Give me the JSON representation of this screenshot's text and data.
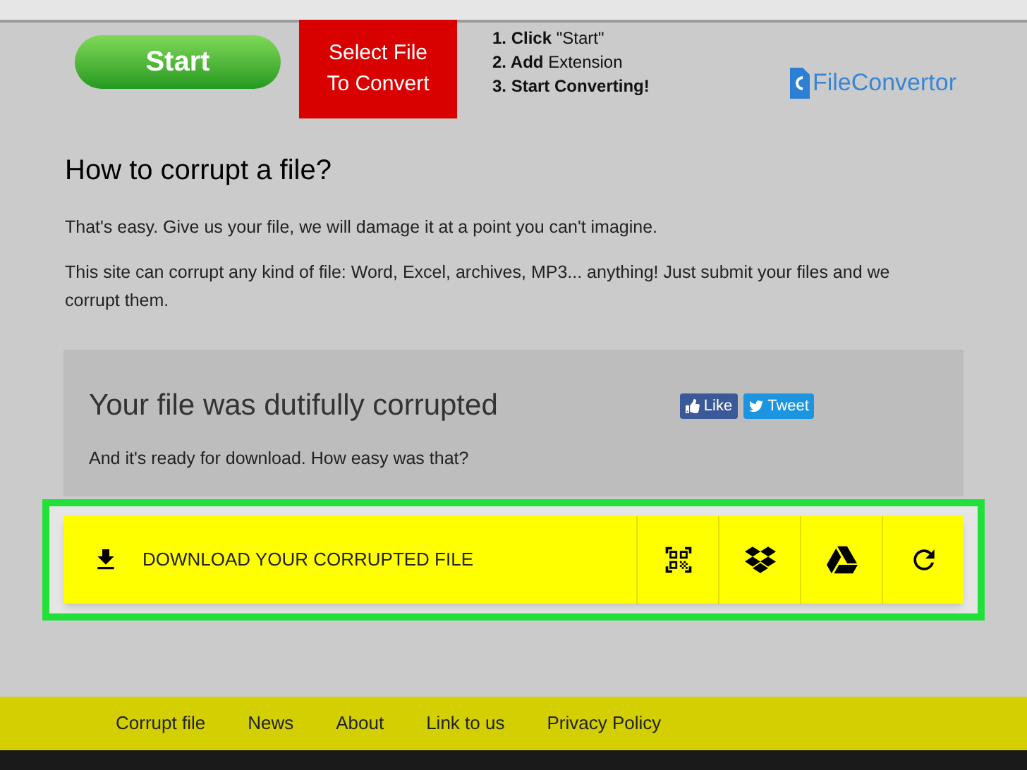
{
  "header": {
    "start_button": "Start",
    "select_button": "Select File To Convert",
    "steps": [
      {
        "text": "**1. Click** \"Start\"",
        "bold": false
      },
      {
        "text": "**2. Add** Extension",
        "bold": false
      },
      {
        "text": "3. Start Converting!",
        "bold": true
      }
    ],
    "logo": "FileConvertor"
  },
  "article": {
    "heading": "How to corrupt a file?",
    "paragraphs": [
      "That's easy. Give us your file, we will damage it at a point you can't imagine.",
      "This site can corrupt any kind of file: Word, Excel, archives, MP3... anything! Just submit your files and we corrupt them."
    ]
  },
  "result_card": {
    "title": "Your file was dutifully corrupted",
    "message": "And it's ready for download. How easy was that?",
    "like_button": "Like",
    "tweet_button": "Tweet"
  },
  "action_bar": {
    "download_label": "DOWNLOAD YOUR CORRUPTED FILE",
    "actions": [
      {
        "kind": "qr"
      },
      {
        "kind": "boxes"
      },
      {
        "kind": "triangle"
      },
      {
        "kind": "refresh"
      }
    ]
  },
  "footer": {
    "links": [
      "Corrupt file",
      "News",
      "About",
      "Link to us",
      "Privacy Policy"
    ]
  }
}
